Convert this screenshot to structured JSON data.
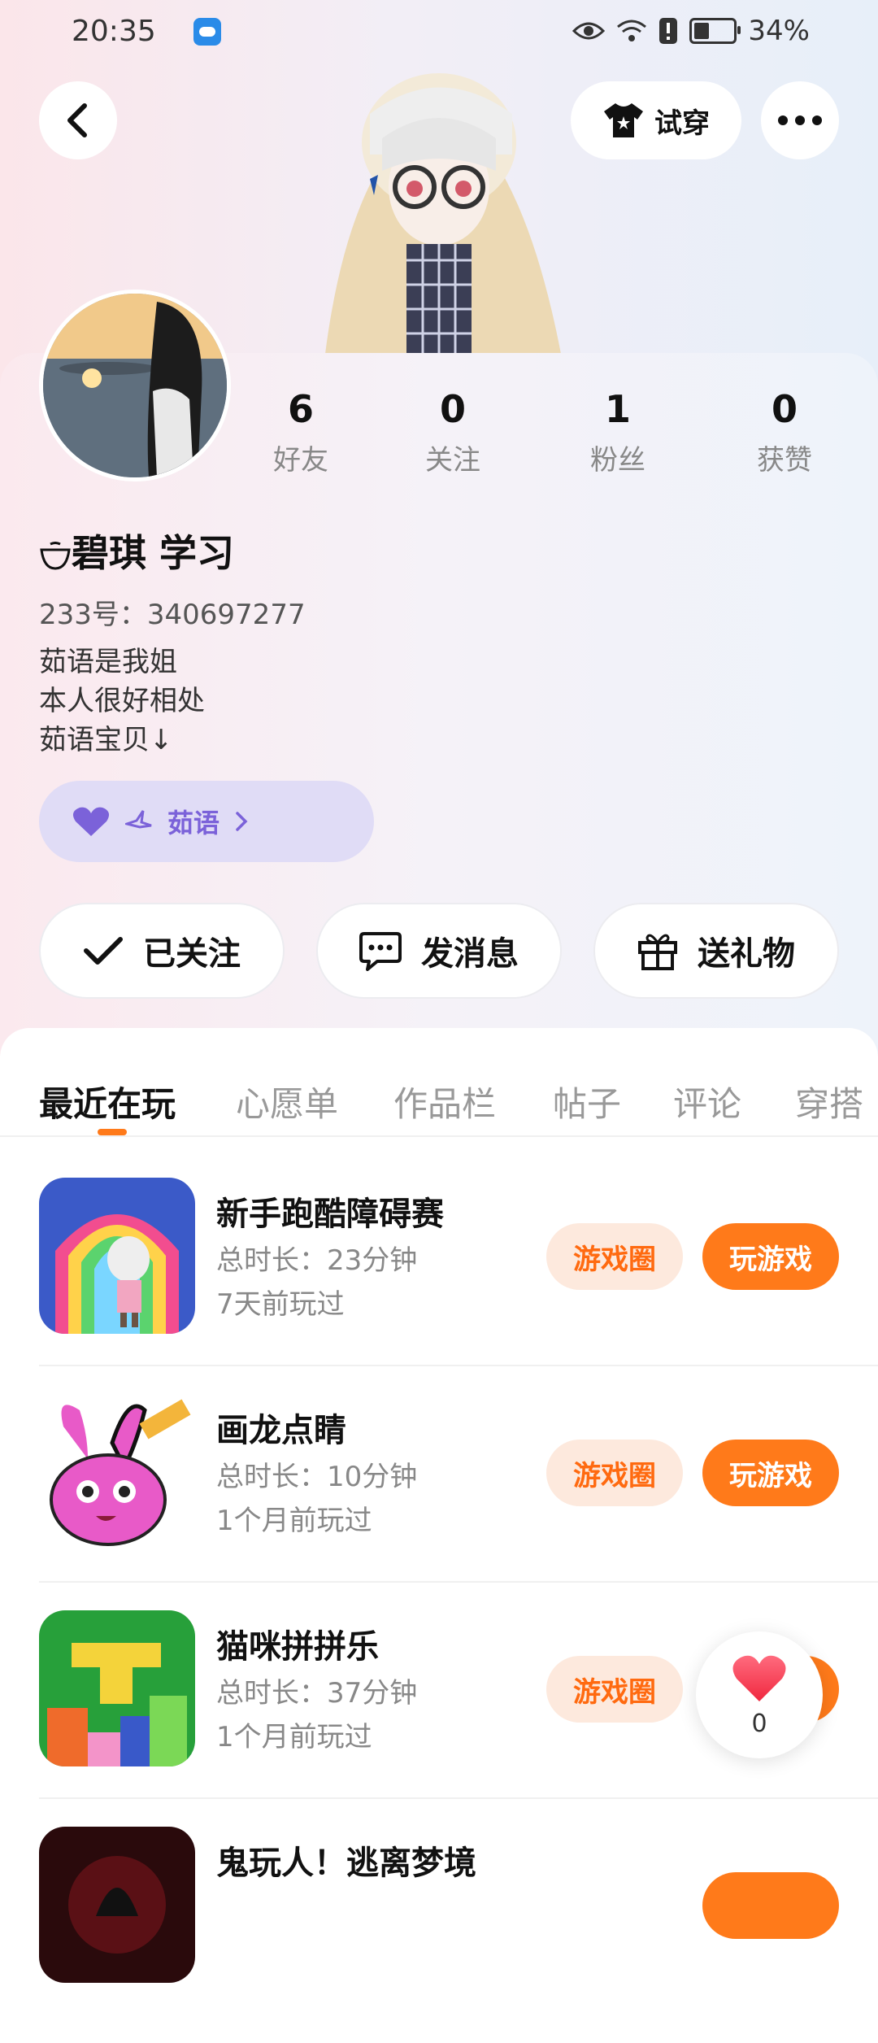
{
  "status_bar": {
    "time": "20:35",
    "battery": "34%"
  },
  "header": {
    "try_on_label": "试穿"
  },
  "stats": [
    {
      "value": "6",
      "label": "好友"
    },
    {
      "value": "0",
      "label": "关注"
    },
    {
      "value": "1",
      "label": "粉丝"
    },
    {
      "value": "0",
      "label": "获赞"
    }
  ],
  "profile": {
    "name": "碧琪 学习",
    "id_text": "233号：340697277",
    "bio": [
      "茹语是我姐",
      "本人很好相处",
      "茹语宝贝↓"
    ]
  },
  "fan_tag": {
    "label": "茹语"
  },
  "actions": {
    "follow_label": "已关注",
    "message_label": "发消息",
    "gift_label": "送礼物"
  },
  "tabs": [
    "最近在玩",
    "心愿单",
    "作品栏",
    "帖子",
    "评论",
    "穿搭"
  ],
  "games": [
    {
      "title": "新手跑酷障碍赛",
      "duration": "总时长：23分钟",
      "last_played": "7天前玩过",
      "circle_label": "游戏圈",
      "play_label": "玩游戏"
    },
    {
      "title": "画龙点睛",
      "duration": "总时长：10分钟",
      "last_played": "1个月前玩过",
      "circle_label": "游戏圈",
      "play_label": "玩游戏"
    },
    {
      "title": "猫咪拼拼乐",
      "duration": "总时长：37分钟",
      "last_played": "1个月前玩过",
      "circle_label": "游戏圈",
      "play_label": "玩游戏"
    },
    {
      "title": "鬼玩人！逃离梦境",
      "duration": "",
      "last_played": "",
      "circle_label": "",
      "play_label": ""
    }
  ],
  "like_float": {
    "count": "0"
  },
  "colors": {
    "accent": "#ff7a1a",
    "accent_light": "#fde9dd",
    "fan_tag_bg": "#e0dcf6",
    "fan_tag_text": "#7b62d9"
  },
  "icons": [
    "back-icon",
    "tshirt-icon",
    "more-icon",
    "check-icon",
    "message-icon",
    "gift-icon",
    "heart-icon"
  ]
}
